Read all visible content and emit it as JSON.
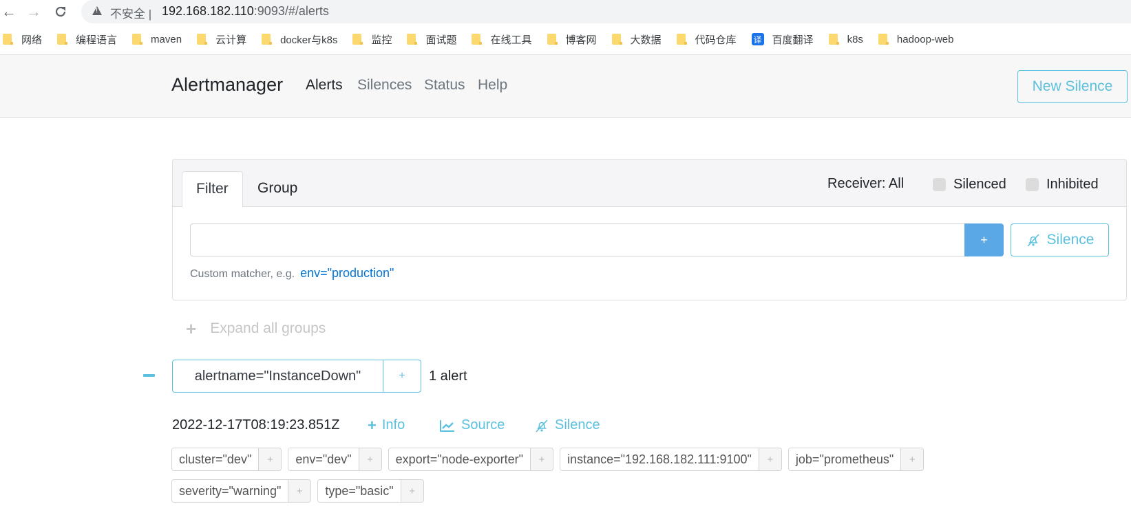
{
  "browser": {
    "back_icon": "arrow-left-icon",
    "forward_icon": "arrow-right-icon",
    "reload_icon": "reload-icon",
    "security_label": "不安全",
    "url_host": "192.168.182.110",
    "url_rest": ":9093/#/alerts",
    "bookmarks": [
      {
        "label": "网络",
        "icon": "folder-icon"
      },
      {
        "label": "编程语言",
        "icon": "folder-icon"
      },
      {
        "label": "maven",
        "icon": "folder-icon"
      },
      {
        "label": "云计算",
        "icon": "folder-icon"
      },
      {
        "label": "docker与k8s",
        "icon": "folder-icon"
      },
      {
        "label": "监控",
        "icon": "folder-icon"
      },
      {
        "label": "面试题",
        "icon": "folder-icon"
      },
      {
        "label": "在线工具",
        "icon": "folder-icon"
      },
      {
        "label": "博客网",
        "icon": "folder-icon"
      },
      {
        "label": "大数据",
        "icon": "folder-icon"
      },
      {
        "label": "代码仓库",
        "icon": "folder-icon"
      },
      {
        "label": "百度翻译",
        "icon": "translate-icon",
        "glyph": "译"
      },
      {
        "label": "k8s",
        "icon": "folder-icon"
      },
      {
        "label": "hadoop-web",
        "icon": "folder-icon"
      }
    ]
  },
  "navbar": {
    "brand": "Alertmanager",
    "links": [
      {
        "label": "Alerts",
        "active": true
      },
      {
        "label": "Silences",
        "active": false
      },
      {
        "label": "Status",
        "active": false
      },
      {
        "label": "Help",
        "active": false
      }
    ],
    "new_silence": "New Silence"
  },
  "filter": {
    "tabs": [
      {
        "label": "Filter",
        "active": true
      },
      {
        "label": "Group",
        "active": false
      }
    ],
    "receiver": "Receiver: All",
    "silenced_label": "Silenced",
    "silenced_checked": false,
    "inhibited_label": "Inhibited",
    "inhibited_checked": false,
    "input_value": "",
    "add_button": "+",
    "silence_button": "Silence",
    "hint_text": "Custom matcher, e.g.",
    "hint_example": "env=\"production\""
  },
  "expand_all": "Expand all groups",
  "group": {
    "label": "alertname=\"InstanceDown\"",
    "add": "+",
    "count": "1 alert"
  },
  "alert": {
    "timestamp": "2022-12-17T08:19:23.851Z",
    "actions": {
      "info": "Info",
      "source": "Source",
      "silence": "Silence"
    },
    "labels": [
      "cluster=\"dev\"",
      "env=\"dev\"",
      "export=\"node-exporter\"",
      "instance=\"192.168.182.111:9100\"",
      "job=\"prometheus\"",
      "severity=\"warning\"",
      "type=\"basic\""
    ],
    "label_add": "+"
  },
  "colors": {
    "accent": "#5bc0de",
    "primary_button": "#5aa8e6",
    "link": "#0275d8"
  }
}
